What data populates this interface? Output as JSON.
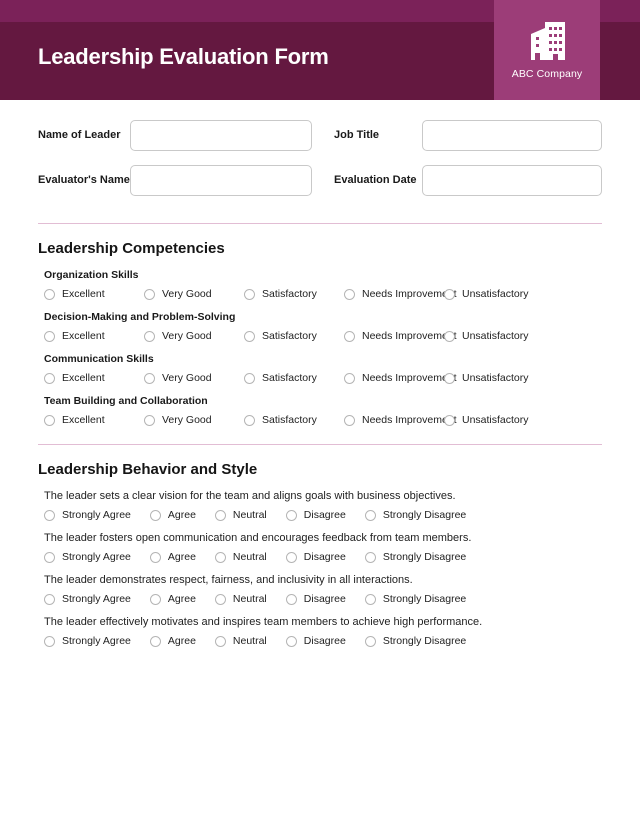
{
  "header": {
    "title": "Leadership Evaluation Form",
    "logo": {
      "icon": "office-building-icon",
      "label": "ABC Company"
    },
    "band_top_color": "#7b2259",
    "band_main_color": "#641840",
    "logo_box_color": "#9c3d78"
  },
  "fields": [
    {
      "label_left": "Name of Leader",
      "value_left": "",
      "label_right": "Job Title",
      "value_right": ""
    },
    {
      "label_left": "Evaluator's Name",
      "value_left": "",
      "label_right": "Evaluation Date",
      "value_right": ""
    }
  ],
  "competencies_section": {
    "title": "Leadership Competencies",
    "scale": [
      "Excellent",
      "Very Good",
      "Satisfactory",
      "Needs Improvement",
      "Unsatisfactory"
    ],
    "items": [
      "Organization Skills",
      "Decision-Making and Problem-Solving",
      "Communication Skills",
      "Team Building and Collaboration"
    ]
  },
  "behavior_section": {
    "title": "Leadership Behavior and Style",
    "scale": [
      "Strongly Agree",
      "Agree",
      "Neutral",
      "Disagree",
      "Strongly Disagree"
    ],
    "statements": [
      "The leader sets a clear vision for the team and aligns goals with business objectives.",
      "The leader fosters open communication and encourages feedback from team members.",
      "The leader demonstrates respect, fairness, and inclusivity in all interactions.",
      "The leader effectively motivates and inspires team members to achieve high performance."
    ]
  },
  "divider_color": "#e2bdd4"
}
